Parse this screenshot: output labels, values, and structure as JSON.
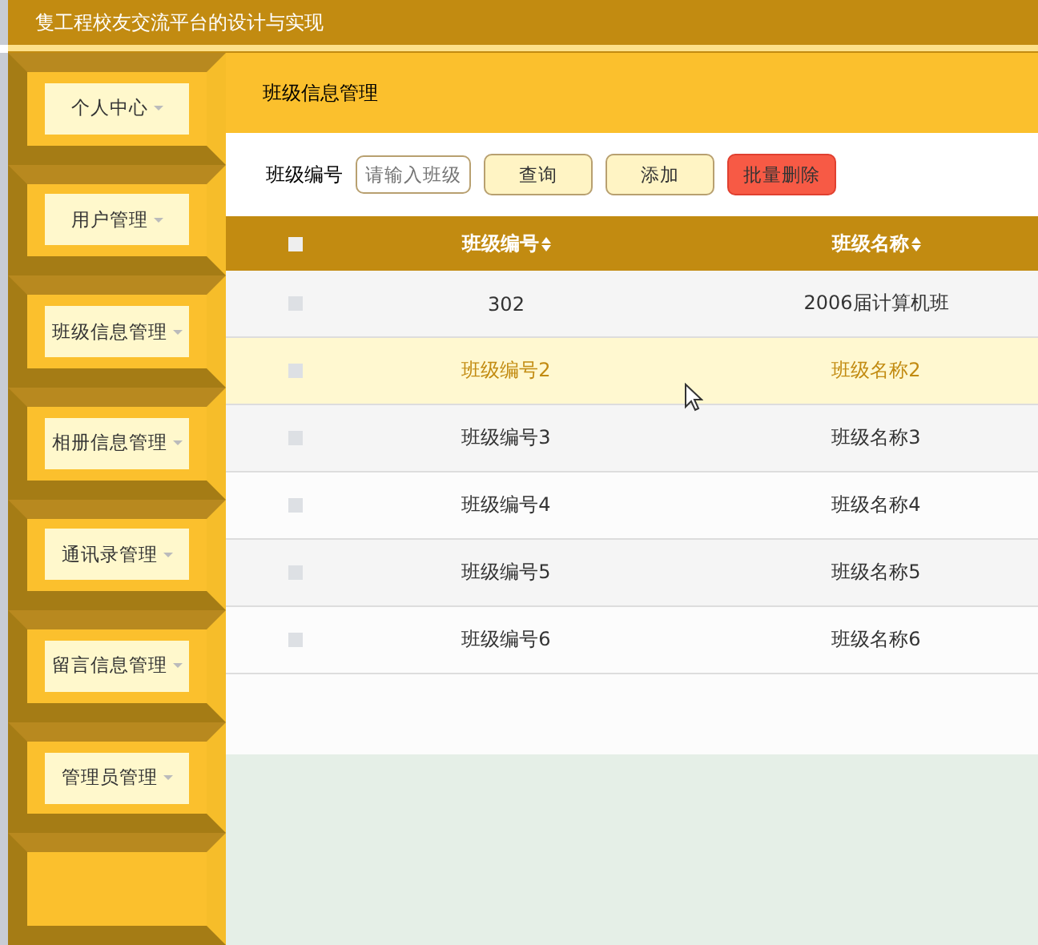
{
  "window": {
    "title": "隻工程校友交流平台的设计与实现"
  },
  "sidebar": {
    "items": [
      {
        "label": "个人中心"
      },
      {
        "label": "用户管理"
      },
      {
        "label": "班级信息管理"
      },
      {
        "label": "相册信息管理"
      },
      {
        "label": "通讯录管理"
      },
      {
        "label": "留言信息管理"
      },
      {
        "label": "管理员管理"
      }
    ]
  },
  "page_header": {
    "title": "班级信息管理"
  },
  "search": {
    "label": "班级编号",
    "placeholder": "请输入班级",
    "buttons": [
      {
        "label": "查询",
        "kind": "normal"
      },
      {
        "label": "添加",
        "kind": "normal"
      },
      {
        "label": "批量删除",
        "kind": "danger"
      }
    ]
  },
  "table": {
    "select_all": {
      "checked": false
    },
    "columns": [
      "班级编号",
      "班级名称"
    ],
    "rows": [
      {
        "checked": false,
        "highlighted": false,
        "cells": [
          "302",
          "2006届计算机班"
        ]
      },
      {
        "checked": false,
        "highlighted": true,
        "cells": [
          "班级编号2",
          "班级名称2"
        ]
      },
      {
        "checked": false,
        "highlighted": false,
        "cells": [
          "班级编号3",
          "班级名称3"
        ]
      },
      {
        "checked": false,
        "highlighted": false,
        "cells": [
          "班级编号4",
          "班级名称4"
        ]
      },
      {
        "checked": false,
        "highlighted": false,
        "cells": [
          "班级编号5",
          "班级名称5"
        ]
      },
      {
        "checked": false,
        "highlighted": false,
        "cells": [
          "班级编号6",
          "班级名称6"
        ]
      }
    ]
  }
}
